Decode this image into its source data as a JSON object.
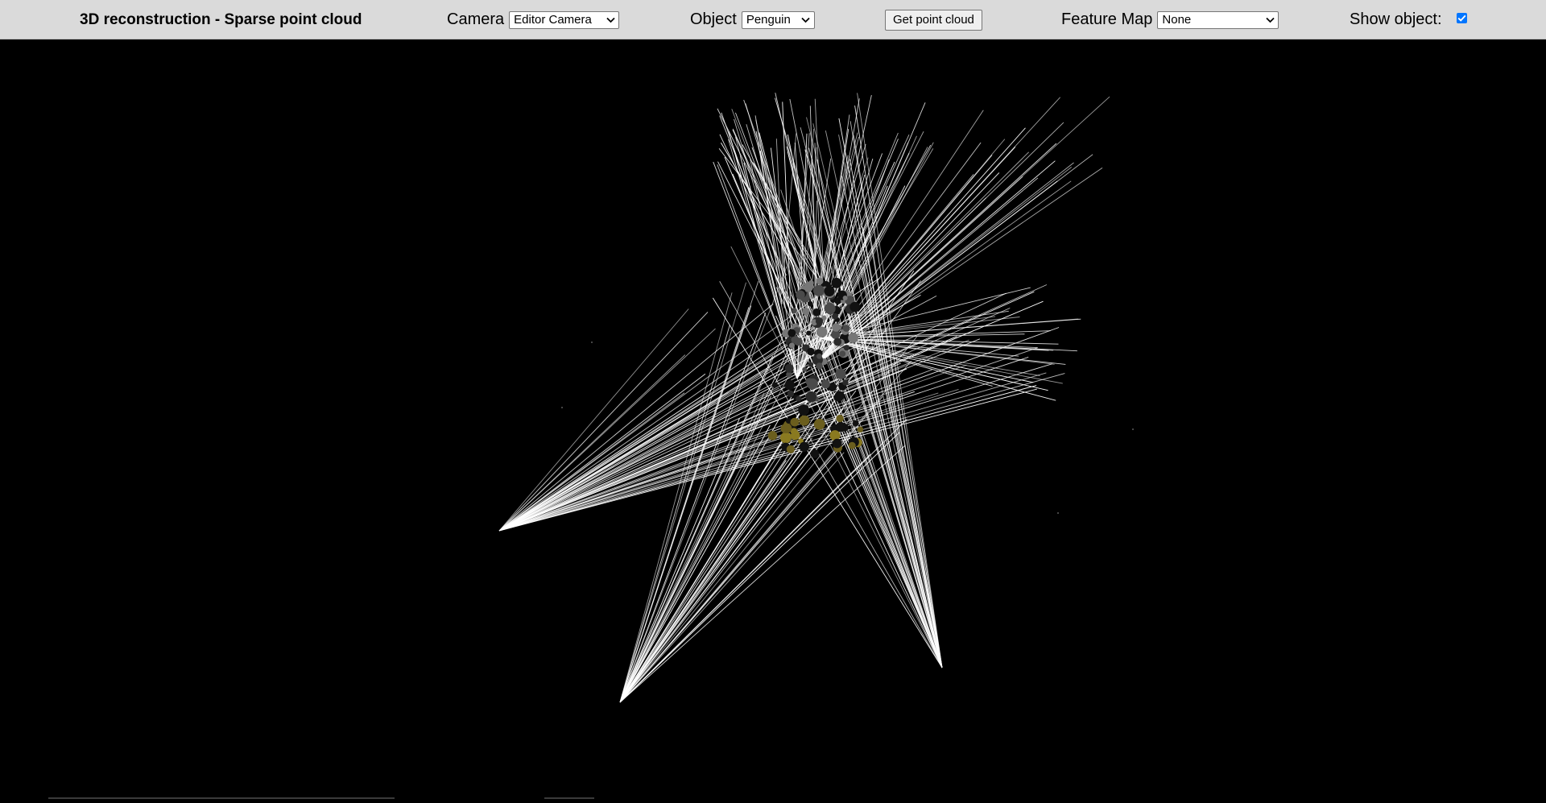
{
  "header": {
    "title": "3D reconstruction - Sparse point cloud",
    "camera": {
      "label": "Camera",
      "selected": "Editor Camera"
    },
    "object": {
      "label": "Object",
      "selected": "Penguin"
    },
    "get_point_cloud_label": "Get point cloud",
    "feature_map": {
      "label": "Feature Map",
      "selected": "None"
    },
    "show_object": {
      "label": "Show object:",
      "checked": true
    }
  },
  "scene": {
    "background_color": "#000000",
    "ray_color": "#ffffff",
    "point_colors": [
      "#111111",
      "#4a4a4a",
      "#777777",
      "#6b5e1e",
      "#8a7a20",
      "#2a2a2a"
    ]
  },
  "colors": {
    "toolbar_bg": "#dadada",
    "checkbox_accent": "#0075ff"
  }
}
